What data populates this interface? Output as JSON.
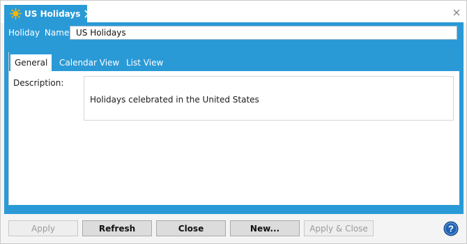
{
  "colors": {
    "accent": "#2a9ad7",
    "sun_icon": "#f5b800",
    "button_bg": "#dcdcdc",
    "disabled_text": "#9a9a9a",
    "help_icon": "#1e63b6"
  },
  "tab": {
    "title": "US Holidays",
    "icon": "sun-icon",
    "close_icon": "close-icon"
  },
  "window": {
    "close_icon": "close-icon"
  },
  "form": {
    "name_label": "Holiday Name:",
    "name_value": "US Holidays"
  },
  "subtabs": [
    {
      "label": "General",
      "active": true
    },
    {
      "label": "Calendar View",
      "active": false
    },
    {
      "label": "List View",
      "active": false
    }
  ],
  "general": {
    "description_label": "Description:",
    "description_value": "Holidays celebrated in the United States"
  },
  "buttons": {
    "apply": "Apply",
    "refresh": "Refresh",
    "close": "Close",
    "new": "New...",
    "apply_close": "Apply & Close"
  },
  "help_icon": "help-icon"
}
